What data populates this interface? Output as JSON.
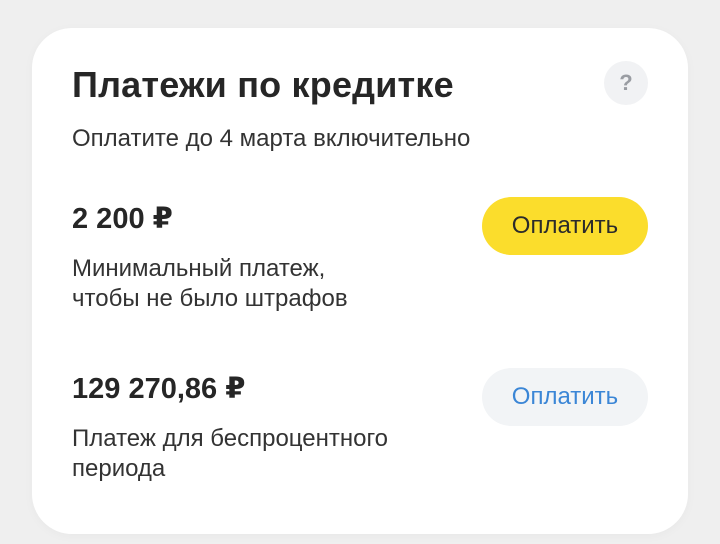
{
  "card": {
    "title": "Платежи по кредитке",
    "help_label": "?",
    "subtitle": "Оплатите до 4 марта включительно"
  },
  "payments": [
    {
      "amount": "2 200 ₽",
      "description_lines": [
        "Минимальный платеж,",
        "чтобы не было штрафов"
      ],
      "button_label": "Оплатить",
      "button_style": "primary"
    },
    {
      "amount": "129 270,86 ₽",
      "description_lines": [
        "Платеж для беспроцентного",
        "периода"
      ],
      "button_label": "Оплатить",
      "button_style": "secondary"
    }
  ],
  "colors": {
    "primary_button": "#fbdd2c",
    "secondary_button": "#f2f4f6",
    "link_text": "#3b86d6",
    "background": "#efefef",
    "card": "#ffffff"
  }
}
